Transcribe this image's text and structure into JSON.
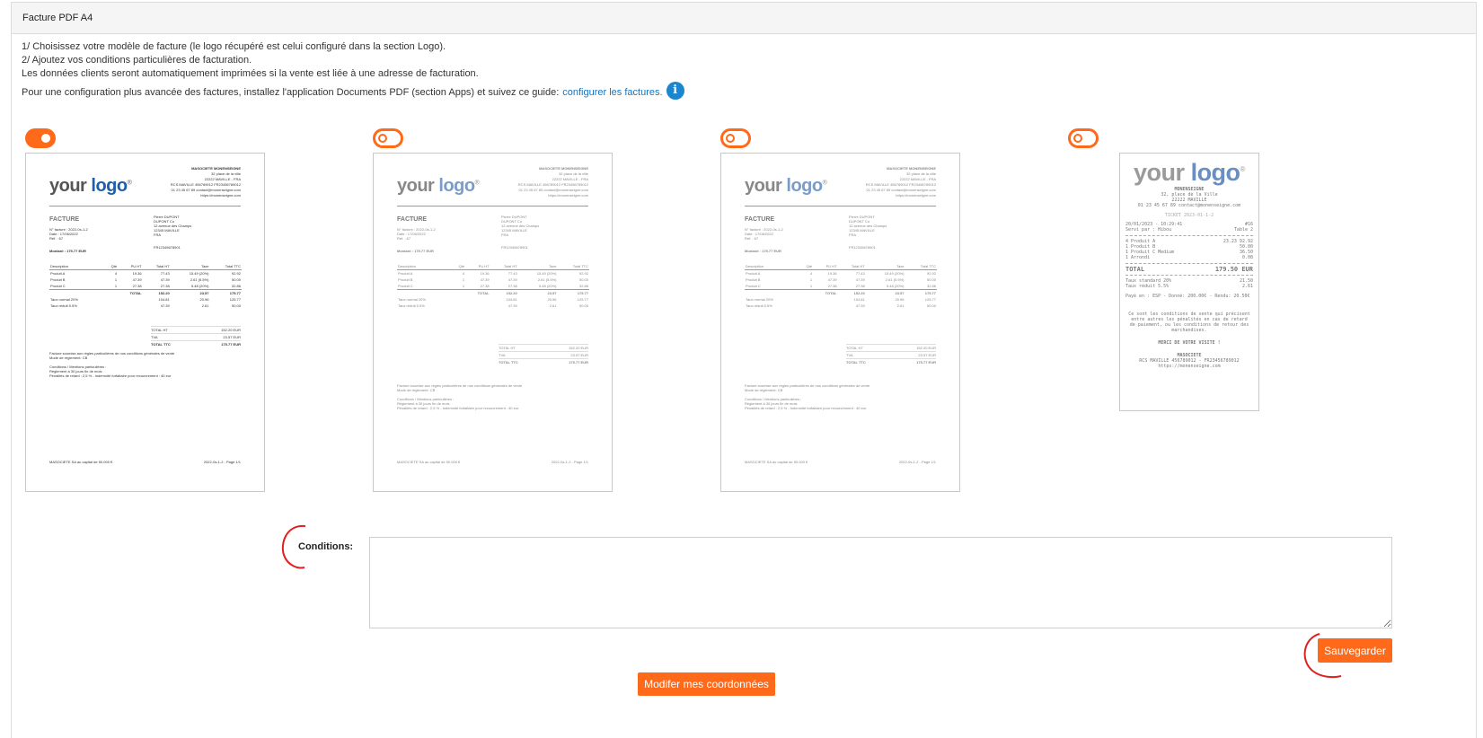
{
  "panel": {
    "title": "Facture PDF A4"
  },
  "intro": {
    "line1": "1/ Choisissez votre modèle de facture (le logo récupéré est celui configuré dans la section Logo).",
    "line2": "2/ Ajoutez vos conditions particulières de facturation.",
    "line3": "Les données clients seront automatiquement imprimées si la vente est liée à une adresse de facturation.",
    "guide_text": "Pour une configuration plus avancée des factures, installez l'application Documents PDF (section Apps) et suivez ce guide:",
    "guide_link": "configurer les factures.",
    "info_icon": "i"
  },
  "templates": [
    {
      "selected": true
    },
    {
      "selected": false
    },
    {
      "selected": false
    },
    {
      "selected": false
    }
  ],
  "invoice": {
    "logo_your": "your",
    "logo_logo": "logo",
    "logo_mark": "®",
    "company_name": "MASOCIETE MONENSEIGNE",
    "company_lines": [
      "32 place de la ville",
      "22222 MAVILLE - FRA",
      "RCS MAVILLE 456789012 FR23456789012",
      "01 23 45 67 89 contact@monenseigne.com",
      "https://monenseigne.com"
    ],
    "title": "FACTURE",
    "meta": [
      "N° facture : 2022-0s-1-2",
      "Date : 17/06/2022",
      "Réf. : 67"
    ],
    "client": [
      "Pierre DUPONT",
      "DUPONT Co",
      "12 avenue des Champs",
      "12345 MAVILLE",
      "FRA"
    ],
    "amount": "Montant : 175.77 EUR",
    "vat_number": "FR12345678901",
    "columns": [
      "Description",
      "Qté",
      "PU HT",
      "Total HT",
      "Taxe",
      "Total TTC"
    ],
    "rows": [
      [
        "Produit A",
        "4",
        "19.36",
        "77.43",
        "15.49 (20%)",
        "92.92"
      ],
      [
        "Produit B",
        "1",
        "47.39",
        "47.39",
        "2.61 (5.5%)",
        "50.00"
      ],
      [
        "Produit C",
        "1",
        "27.38",
        "27.38",
        "5.48 (20%)",
        "32.86"
      ]
    ],
    "total_row": [
      "",
      "",
      "TOTAL",
      "152.20",
      "23.57",
      "175.77"
    ],
    "tax_rows": [
      [
        "Taux normal 20%",
        "",
        "",
        "104.81",
        "20.96",
        "125.77"
      ],
      [
        "Taux réduit 5.5%",
        "",
        "",
        "47.39",
        "2.61",
        "50.00"
      ]
    ],
    "totals": [
      [
        "TOTAL HT",
        "152.20 EUR"
      ],
      [
        "TVA",
        "23.57 EUR"
      ],
      [
        "TOTAL TTC",
        "175.77 EUR"
      ]
    ],
    "notes": [
      "Facture soumise aux règles particulières de nos conditions générales de vente",
      "Mode de règlement: CB",
      "",
      "Conditions / Mentions particulières :",
      "Règlement à 30 jours fin de mois",
      "Pénalités de retard : 2,5 % - Indemnité forfaitaire pour recouvrement : 40 eur"
    ],
    "footer_left": "MASOCIETE SA au capital de 50.000 €",
    "footer_right": "2022-0s-1-2 - Page 1/1"
  },
  "ticket": {
    "company": "MONENSEIGNE",
    "address1": "32, place de la Ville",
    "address2": "22222 MAVILLE",
    "contact": "01 23 45 67 89 contact@monenseigne.com",
    "ticket_no": "TICKET 2023-01-1-2",
    "date": "20/01/2023 - 10:29:41",
    "order_no": "#16",
    "served": "Servi par : Hibou",
    "table": "Table 2",
    "lines": [
      [
        "4 Produit A",
        "23.23  92.92"
      ],
      [
        "1 Produit B",
        "50.00"
      ],
      [
        "1 Produit C Medium",
        "36.50"
      ],
      [
        "1 Arrondi",
        "0.08"
      ]
    ],
    "total_label": "TOTAL",
    "total_value": "179.50 EUR",
    "tax1": [
      "Taux standard 20%",
      "21.50"
    ],
    "tax2": [
      "Taux réduit 5.5%",
      "2.61"
    ],
    "payment": "Payé en : ESP - Donné: 200.00€ - Rendu: 20.50€",
    "conditions": "Ce sont les conditions de vente qui précisent entre autres les pénalités en cas de retard de paiement, ou les conditions de retour des marchandises.",
    "thanks": "MERCI DE VOTRE VISITE !",
    "footer_company": "MASOCIETE",
    "footer_rcs": "RCS MAVILLE 456789012 - FR23456789012",
    "footer_url": "https://monenseigne.com"
  },
  "conditions": {
    "label": "Conditions:",
    "value": ""
  },
  "buttons": {
    "save": "Sauvegarder",
    "edit_coords": "Modifer mes coordonnées"
  },
  "colors": {
    "accent": "#ff6a1a",
    "link": "#1a73b8",
    "info": "#1a86d0",
    "annotation": "#e02020"
  }
}
